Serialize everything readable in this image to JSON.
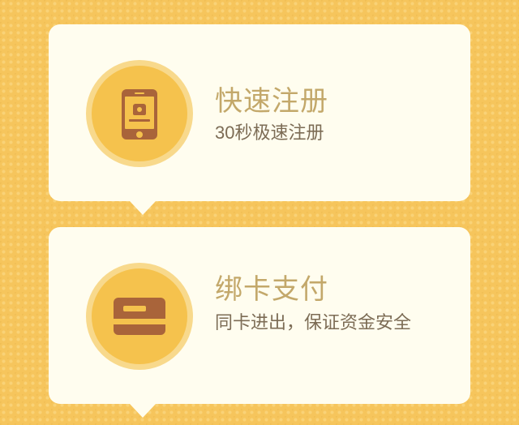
{
  "colors": {
    "background": "#f6c55c",
    "card": "#fffdef",
    "icon_ring": "#f8d98c",
    "icon_disc": "#f5c24d",
    "icon_glyph": "#a9643a",
    "title": "#c3a86a",
    "subtitle": "#7c6c55"
  },
  "features": [
    {
      "title": "快速注册",
      "subtitle": "30秒极速注册",
      "icon": "mobile-phone-icon"
    },
    {
      "title": "绑卡支付",
      "subtitle": "同卡进出，保证资金安全",
      "icon": "bank-card-icon"
    }
  ]
}
